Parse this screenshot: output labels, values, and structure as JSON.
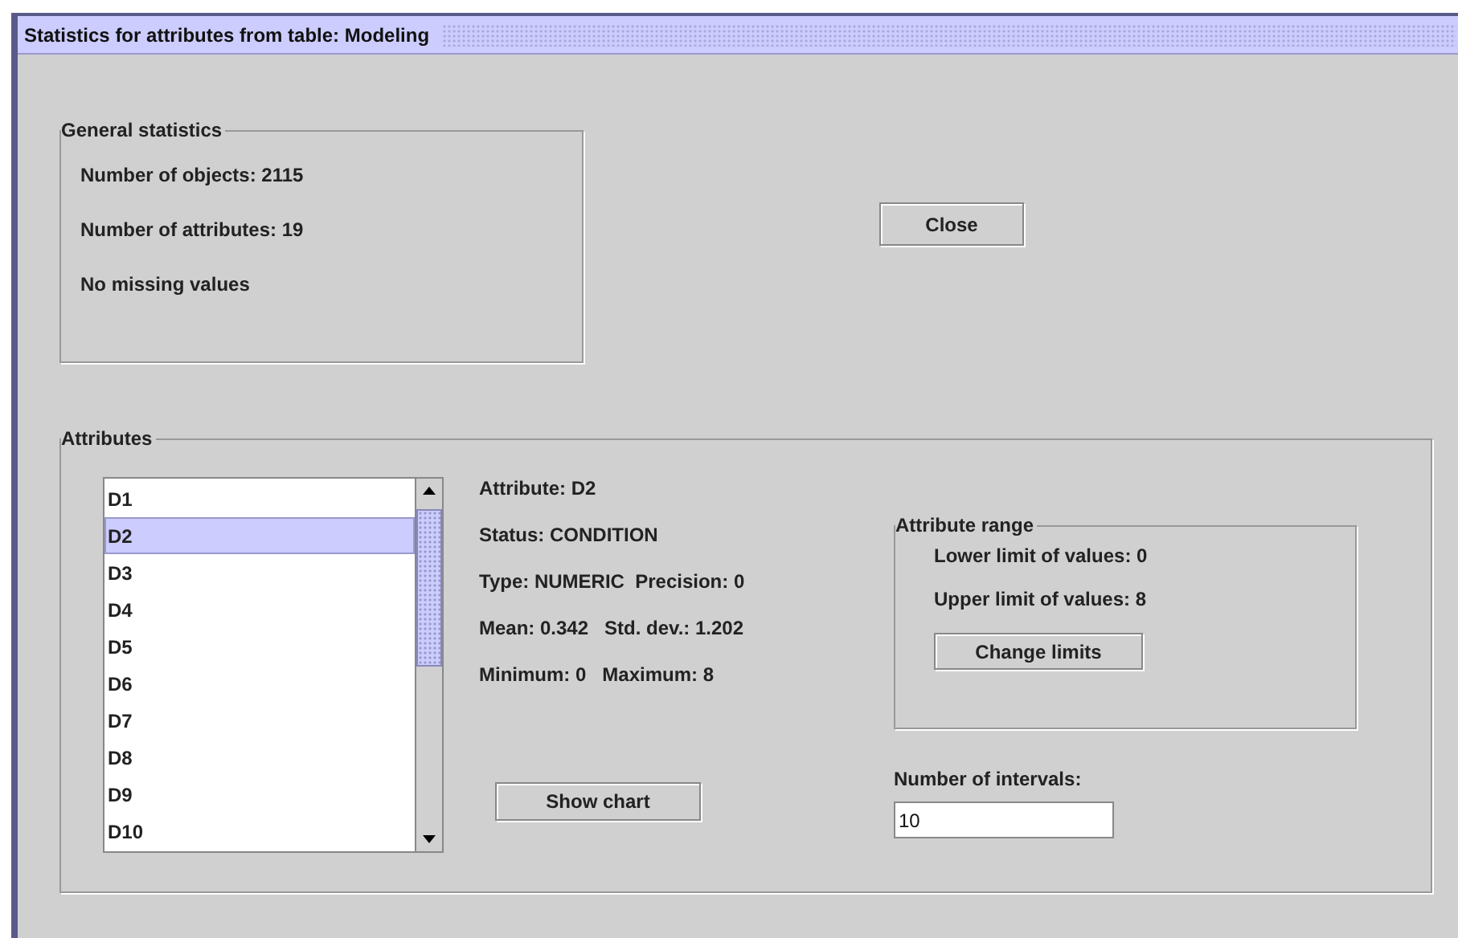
{
  "window": {
    "title": "Statistics for attributes from table: Modeling"
  },
  "general_statistics": {
    "title": "General statistics",
    "lines": [
      "Number of objects: 2115",
      "Number of attributes: 19",
      "No missing values"
    ]
  },
  "close_button": "Close",
  "attributes": {
    "title": "Attributes",
    "list": [
      {
        "label": "D1",
        "selected": false
      },
      {
        "label": "D2",
        "selected": true
      },
      {
        "label": "D3",
        "selected": false
      },
      {
        "label": "D4",
        "selected": false
      },
      {
        "label": "D5",
        "selected": false
      },
      {
        "label": "D6",
        "selected": false
      },
      {
        "label": "D7",
        "selected": false
      },
      {
        "label": "D8",
        "selected": false
      },
      {
        "label": "D9",
        "selected": false
      },
      {
        "label": "D10",
        "selected": false
      }
    ],
    "details": [
      "Attribute: D2",
      "Status: CONDITION",
      "Type: NUMERIC  Precision: 0",
      "Mean: 0.342   Std. dev.: 1.202",
      "Minimum: 0   Maximum: 8"
    ],
    "show_chart_button": "Show chart",
    "attribute_range": {
      "title": "Attribute range",
      "lines": [
        "Lower limit of values: 0",
        "Upper limit of values: 8"
      ],
      "button": "Change limits"
    },
    "intervals": {
      "label": "Number of intervals:",
      "value": "10"
    }
  }
}
